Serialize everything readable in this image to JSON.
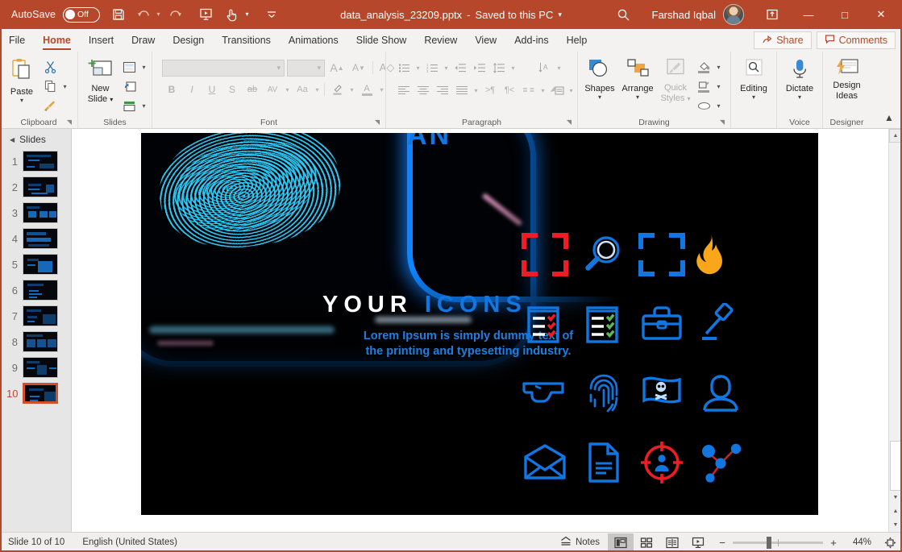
{
  "titlebar": {
    "autosave_label": "AutoSave",
    "autosave_state": "Off",
    "save_icon": "save-icon",
    "undo_icon": "undo-icon",
    "redo_icon": "redo-icon",
    "present_icon": "start-presentation-icon",
    "touch_icon": "touch-mode-icon",
    "more_icon": "customize-quick-access-icon",
    "document_title": "data_analysis_23209.pptx",
    "separator": "-",
    "saved_status": "Saved to this PC",
    "search_icon": "search-icon",
    "user_name": "Farshad Iqbal",
    "avatar": "user-avatar",
    "ribbon_display_icon": "ribbon-display-options-icon",
    "minimize": "—",
    "maximize": "□",
    "close": "✕"
  },
  "tabs": [
    {
      "label": "File",
      "active": false
    },
    {
      "label": "Home",
      "active": true
    },
    {
      "label": "Insert",
      "active": false
    },
    {
      "label": "Draw",
      "active": false
    },
    {
      "label": "Design",
      "active": false
    },
    {
      "label": "Transitions",
      "active": false
    },
    {
      "label": "Animations",
      "active": false
    },
    {
      "label": "Slide Show",
      "active": false
    },
    {
      "label": "Review",
      "active": false
    },
    {
      "label": "View",
      "active": false
    },
    {
      "label": "Add-ins",
      "active": false
    },
    {
      "label": "Help",
      "active": false
    }
  ],
  "tabbar_right": {
    "share_label": "Share",
    "share_icon": "share-icon",
    "comments_label": "Comments",
    "comments_icon": "comment-icon"
  },
  "ribbon": {
    "groups": [
      {
        "name": "Clipboard",
        "label": "Clipboard",
        "has_dialog_launcher": true
      },
      {
        "name": "Slides",
        "label": "Slides",
        "has_dialog_launcher": false
      },
      {
        "name": "Font",
        "label": "Font",
        "has_dialog_launcher": true
      },
      {
        "name": "Paragraph",
        "label": "Paragraph",
        "has_dialog_launcher": true
      },
      {
        "name": "Drawing",
        "label": "Drawing",
        "has_dialog_launcher": true
      },
      {
        "name": "Editing",
        "label": "",
        "has_dialog_launcher": false
      },
      {
        "name": "Voice",
        "label": "Voice",
        "has_dialog_launcher": false
      },
      {
        "name": "Designer",
        "label": "Designer",
        "has_dialog_launcher": false
      }
    ],
    "clipboard": {
      "paste_label": "Paste",
      "paste_icon": "paste-icon",
      "cut_icon": "cut-icon",
      "copy_icon": "copy-icon",
      "format_painter_icon": "format-painter-icon"
    },
    "slides": {
      "new_slide_line1": "New",
      "new_slide_line2": "Slide",
      "new_slide_icon": "new-slide-icon",
      "layout_icon": "layout-icon",
      "reset_icon": "reset-icon",
      "section_icon": "section-icon"
    },
    "font": {
      "font_name_value": "",
      "font_size_value": "",
      "grow_font": "A",
      "shrink_font": "A",
      "clear_formatting_icon": "clear-formatting-icon",
      "bold": "B",
      "italic": "I",
      "underline": "U",
      "shadow": "S",
      "strikethrough": "ab",
      "character_spacing": "AV",
      "change_case": "Aa",
      "text_highlight_icon": "text-highlight-icon",
      "font_color_icon": "font-color-icon"
    },
    "paragraph": {
      "bullets_icon": "bullets-icon",
      "numbering_icon": "numbering-icon",
      "decrease_indent_icon": "decrease-indent-icon",
      "increase_indent_icon": "increase-indent-icon",
      "line_spacing_icon": "line-spacing-icon",
      "align_left_icon": "align-left-icon",
      "align_center_icon": "align-center-icon",
      "align_right_icon": "align-right-icon",
      "justify_icon": "justify-icon",
      "columns_icon": "columns-icon",
      "text_direction_icon": "text-direction-icon",
      "align_text_icon": "align-text-icon",
      "smartart_icon": "convert-to-smartart-icon",
      "ltr_icon": "left-to-right-icon",
      "rtl_icon": "right-to-left-icon"
    },
    "drawing": {
      "shapes_label": "Shapes",
      "shapes_icon": "shapes-icon",
      "arrange_label": "Arrange",
      "arrange_icon": "arrange-icon",
      "quick_styles_line1": "Quick",
      "quick_styles_line2": "Styles",
      "quick_styles_icon": "quick-styles-icon",
      "shape_fill_icon": "shape-fill-icon",
      "shape_outline_icon": "shape-outline-icon",
      "shape_effects_icon": "shape-effects-icon"
    },
    "editing": {
      "label": "Editing",
      "icon": "find-icon"
    },
    "voice": {
      "label": "Dictate",
      "icon": "microphone-icon"
    },
    "designer": {
      "line1": "Design",
      "line2": "Ideas",
      "icon": "design-ideas-icon"
    },
    "collapse_ribbon_icon": "collapse-ribbon-icon"
  },
  "slide_pane": {
    "header_label": "Slides",
    "collapse_icon": "triangle-collapse-icon",
    "slides": [
      {
        "number": "1",
        "selected": false
      },
      {
        "number": "2",
        "selected": false
      },
      {
        "number": "3",
        "selected": false
      },
      {
        "number": "4",
        "selected": false
      },
      {
        "number": "5",
        "selected": false
      },
      {
        "number": "6",
        "selected": false
      },
      {
        "number": "7",
        "selected": false
      },
      {
        "number": "8",
        "selected": false
      },
      {
        "number": "9",
        "selected": false
      },
      {
        "number": "10",
        "selected": true
      }
    ]
  },
  "slide": {
    "top_cutoff_text": "AN",
    "title_white": "YOUR",
    "title_blue": "ICONS",
    "subtitle_line1": "Lorem Ipsum is simply dummy text of",
    "subtitle_line2": "the printing and typesetting industry.",
    "background_image": "fingerprint-on-blue-glowing-phone-photo",
    "colors": {
      "accent_blue": "#1176e0",
      "accent_red": "#ee1c25",
      "accent_orange": "#f9a61a",
      "accent_green": "#4caf50",
      "background": "#000000"
    },
    "icons": [
      {
        "name": "red-scan-frame-icon",
        "color": "#ee1c25"
      },
      {
        "name": "magnifier-icon",
        "color": "#1176e0"
      },
      {
        "name": "blue-scan-frame-icon",
        "color": "#1176e0"
      },
      {
        "name": "flame-icon",
        "color": "#f9a61a"
      },
      {
        "name": "checklist-red-icon",
        "color": "#1176e0"
      },
      {
        "name": "checklist-green-icon",
        "color": "#1176e0"
      },
      {
        "name": "briefcase-icon",
        "color": "#1176e0"
      },
      {
        "name": "gavel-icon",
        "color": "#1176e0"
      },
      {
        "name": "handgun-icon",
        "color": "#1176e0"
      },
      {
        "name": "fingerprint-icon",
        "color": "#1176e0"
      },
      {
        "name": "pirate-flag-icon",
        "color": "#1176e0"
      },
      {
        "name": "user-profile-icon",
        "color": "#1176e0"
      },
      {
        "name": "open-envelope-icon",
        "color": "#1176e0"
      },
      {
        "name": "document-icon",
        "color": "#1176e0"
      },
      {
        "name": "target-person-icon",
        "color": "#ee1c25"
      },
      {
        "name": "network-nodes-icon",
        "color": "#1176e0"
      }
    ]
  },
  "scrollbar": {
    "up_icon": "scroll-up-icon",
    "down_icon": "scroll-down-icon",
    "prev_slide_icon": "previous-slide-icon",
    "next_slide_icon": "next-slide-icon"
  },
  "statusbar": {
    "slide_counter": "Slide 10 of 10",
    "language": "English (United States)",
    "notes_label": "Notes",
    "notes_icon": "notes-icon",
    "views": [
      {
        "name": "normal-view-button",
        "icon": "normal-view-icon",
        "active": true
      },
      {
        "name": "slide-sorter-button",
        "icon": "slide-sorter-icon",
        "active": false
      },
      {
        "name": "reading-view-button",
        "icon": "reading-view-icon",
        "active": false
      },
      {
        "name": "slideshow-button",
        "icon": "slideshow-icon",
        "active": false
      }
    ],
    "zoom_out": "−",
    "zoom_in": "+",
    "zoom_value": "44%",
    "fit_slide_icon": "fit-slide-to-window-icon"
  }
}
